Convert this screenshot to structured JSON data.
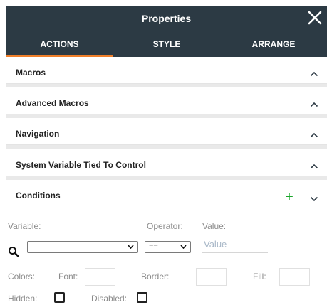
{
  "header": {
    "title": "Properties",
    "close_label": "✕"
  },
  "tabs": [
    {
      "label": "ACTIONS",
      "active": true
    },
    {
      "label": "STYLE",
      "active": false
    },
    {
      "label": "ARRANGE",
      "active": false
    }
  ],
  "sections": [
    {
      "label": "Macros",
      "state": "collapsed"
    },
    {
      "label": "Advanced Macros",
      "state": "collapsed"
    },
    {
      "label": "Navigation",
      "state": "collapsed"
    },
    {
      "label": "System Variable Tied To Control",
      "state": "collapsed"
    },
    {
      "label": "Conditions",
      "state": "expanded"
    }
  ],
  "conditions": {
    "add_label": "+",
    "variable_label": "Variable:",
    "operator_label": "Operator:",
    "value_label": "Value:",
    "variable_value": "",
    "operator_value": "==",
    "value_placeholder": "Value",
    "colors_label": "Colors:",
    "font_label": "Font:",
    "border_label": "Border:",
    "fill_label": "Fill:",
    "hidden_label": "Hidden:",
    "disabled_label": "Disabled:",
    "hidden_checked": false,
    "disabled_checked": false
  },
  "colors": {
    "header_bg": "#2c3a44",
    "active_tab_underline": "#f07f2a",
    "add_green": "#1aa62a"
  }
}
